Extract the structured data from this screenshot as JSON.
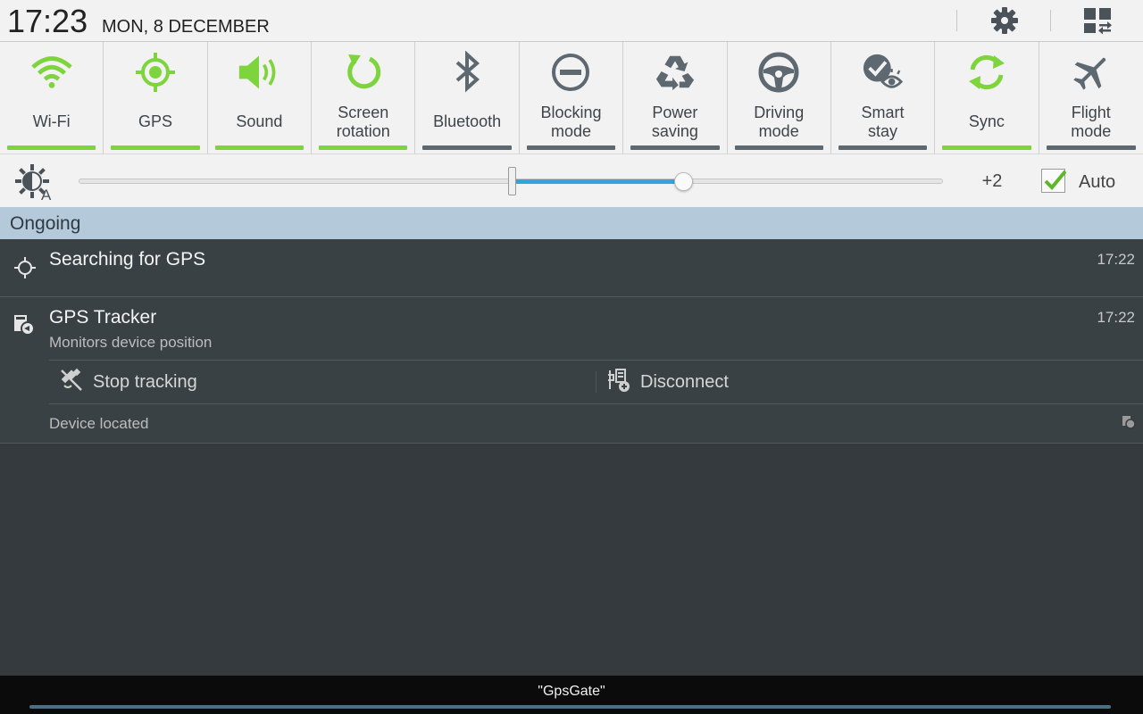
{
  "header": {
    "time": "17:23",
    "date": "MON, 8 DECEMBER",
    "settings_icon": "gear-icon",
    "edit_icon": "grid-edit-icon"
  },
  "quick_settings": [
    {
      "id": "wifi",
      "label": "Wi-Fi",
      "icon": "wifi-icon",
      "on": true
    },
    {
      "id": "gps",
      "label": "GPS",
      "icon": "gps-icon",
      "on": true
    },
    {
      "id": "sound",
      "label": "Sound",
      "icon": "sound-icon",
      "on": true
    },
    {
      "id": "rotation",
      "label": "Screen\nrotation",
      "icon": "rotation-icon",
      "on": true
    },
    {
      "id": "bluetooth",
      "label": "Bluetooth",
      "icon": "bluetooth-icon",
      "on": false
    },
    {
      "id": "blocking",
      "label": "Blocking\nmode",
      "icon": "blocking-icon",
      "on": false
    },
    {
      "id": "power",
      "label": "Power\nsaving",
      "icon": "recycle-icon",
      "on": false
    },
    {
      "id": "driving",
      "label": "Driving\nmode",
      "icon": "steering-wheel-icon",
      "on": false
    },
    {
      "id": "smartstay",
      "label": "Smart\nstay",
      "icon": "eye-check-icon",
      "on": false
    },
    {
      "id": "sync",
      "label": "Sync",
      "icon": "sync-icon",
      "on": true
    },
    {
      "id": "flight",
      "label": "Flight\nmode",
      "icon": "airplane-icon",
      "on": false
    }
  ],
  "brightness": {
    "icon": "brightness-auto-icon",
    "level_label": "+2",
    "auto_label": "Auto",
    "auto_checked": true,
    "slider_fraction": 0.7
  },
  "ongoing": {
    "section_title": "Ongoing",
    "notifications": [
      {
        "title": "Searching for GPS",
        "time": "17:22",
        "icon": "gps-target-icon"
      },
      {
        "title": "GPS Tracker",
        "subtitle": "Monitors device position",
        "time": "17:22",
        "icon": "tracker-icon",
        "actions": [
          {
            "label": "Stop tracking",
            "icon": "satellite-off-icon"
          },
          {
            "label": "Disconnect",
            "icon": "disconnect-icon"
          }
        ],
        "footer": "Device located"
      }
    ]
  },
  "toast": {
    "text": "\"GpsGate\""
  },
  "colors": {
    "accent_on": "#7ED43D",
    "accent_off": "#5D6870",
    "slider": "#33A3DB",
    "section_header": "#B4C9D9",
    "panel_bg": "#343A3D"
  }
}
